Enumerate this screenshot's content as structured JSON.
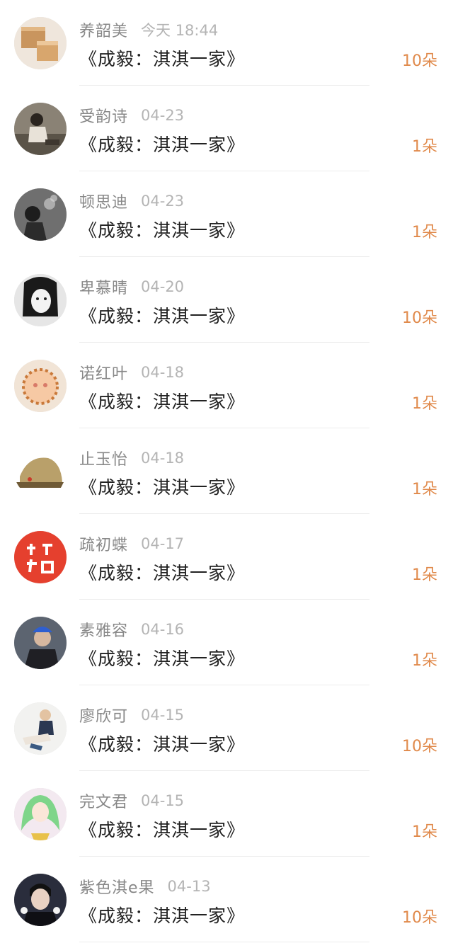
{
  "colors": {
    "name": "#888888",
    "date": "#b4b4b4",
    "title": "#222222",
    "gift": "#e0894a",
    "divider": "#ececec"
  },
  "items": [
    {
      "name": "养韶美",
      "date": "今天 18:44",
      "title": "《成毅：淇淇一家》",
      "gift": "10朵",
      "avatar_icon": "wooden-box-photo"
    },
    {
      "name": "受韵诗",
      "date": "04-23",
      "title": "《成毅：淇淇一家》",
      "gift": "1朵",
      "avatar_icon": "woman-sitting-photo"
    },
    {
      "name": "顿思迪",
      "date": "04-23",
      "title": "《成毅：淇淇一家》",
      "gift": "1朵",
      "avatar_icon": "man-smoking-photo"
    },
    {
      "name": "卑慕晴",
      "date": "04-20",
      "title": "《成毅：淇淇一家》",
      "gift": "10朵",
      "avatar_icon": "woman-portrait-bw"
    },
    {
      "name": "诺红叶",
      "date": "04-18",
      "title": "《成毅：淇淇一家》",
      "gift": "1朵",
      "avatar_icon": "cartoon-face"
    },
    {
      "name": "止玉怡",
      "date": "04-18",
      "title": "《成毅：淇淇一家》",
      "gift": "1朵",
      "avatar_icon": "military-cap"
    },
    {
      "name": "疏初蝶",
      "date": "04-17",
      "title": "《成毅：淇淇一家》",
      "gift": "1朵",
      "avatar_icon": "exam-cheer-badge"
    },
    {
      "name": "素雅容",
      "date": "04-16",
      "title": "《成毅：淇淇一家》",
      "gift": "1朵",
      "avatar_icon": "person-blue-cap"
    },
    {
      "name": "廖欣可",
      "date": "04-15",
      "title": "《成毅：淇淇一家》",
      "gift": "10朵",
      "avatar_icon": "person-sitting"
    },
    {
      "name": "完文君",
      "date": "04-15",
      "title": "《成毅：淇淇一家》",
      "gift": "1朵",
      "avatar_icon": "green-hair-anime"
    },
    {
      "name": "紫色淇e果",
      "date": "04-13",
      "title": "《成毅：淇淇一家》",
      "gift": "10朵",
      "avatar_icon": "man-portrait-dark"
    }
  ]
}
